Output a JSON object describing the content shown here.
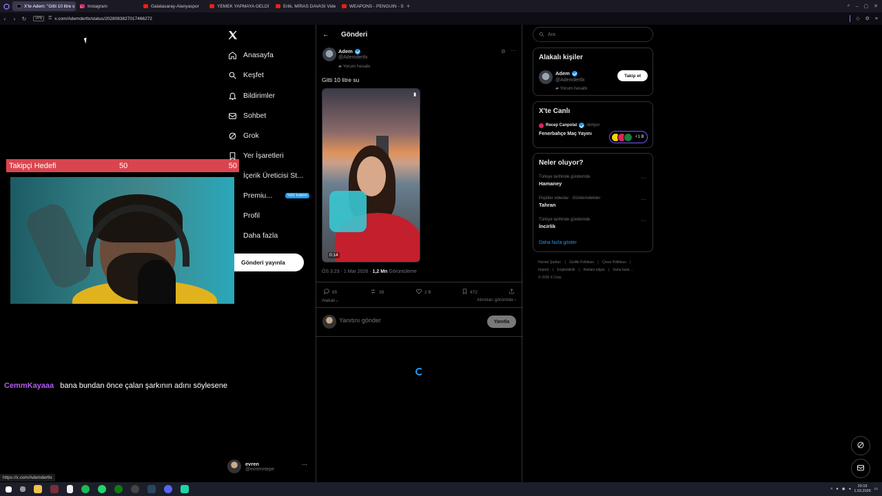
{
  "browser": {
    "tabs": [
      {
        "label": "X'te Adem: \"Gitti 10 litre s",
        "active": true,
        "icon": "x-icon"
      },
      {
        "label": "Instagram",
        "active": false,
        "icon": "instagram-icon"
      },
      {
        "label": "Galatasaray-Alanyaspor",
        "active": false,
        "icon": "youtube-icon"
      },
      {
        "label": "YEMEK YAPMAYA GELDİ",
        "active": false,
        "icon": "youtube-icon"
      },
      {
        "label": "Erlik, MİRAS DAVASI Vide",
        "active": false,
        "icon": "youtube-icon"
      },
      {
        "label": "WEAPONS - PENGUIN - S",
        "active": false,
        "icon": "youtube-icon"
      }
    ],
    "new_tab": "+",
    "vpn_label": "VPN",
    "url": "x.com/Ademdertlx/status/2028083827017466272",
    "status_url": "https://x.com/Ademdertlx"
  },
  "overlay": {
    "follower_goal": {
      "label": "Takipçi Hedefi",
      "current": "50",
      "target": "50"
    },
    "chat": {
      "username": "CemmKayaaa",
      "message": "bana bundan önce çalan şarkının adını söylesene"
    }
  },
  "nav": {
    "items": [
      {
        "label": "Anasayfa",
        "icon": "home-icon"
      },
      {
        "label": "Keşfet",
        "icon": "search-icon"
      },
      {
        "label": "Bildirimler",
        "icon": "bell-icon"
      },
      {
        "label": "Sohbet",
        "icon": "mail-icon"
      },
      {
        "label": "Grok",
        "icon": "grok-icon"
      },
      {
        "label": "Yer İşaretleri",
        "icon": "bookmark-icon"
      },
      {
        "label": "İçerik Üreticisi St...",
        "icon": "creator-icon"
      },
      {
        "label": "Premiu...",
        "icon": "premium-icon"
      },
      {
        "label": "Profil",
        "icon": "profile-icon"
      },
      {
        "label": "Daha fazla",
        "icon": "more-icon"
      }
    ],
    "premium_badge": "%50 İndirim",
    "post_button": "Gönderi yayınla",
    "account": {
      "name": "evren",
      "handle": "@evrenntepe",
      "more": "···"
    }
  },
  "post": {
    "header_title": "Gönderi",
    "author": {
      "name": "Adem",
      "handle": "@Ademdertlx",
      "tag": "Yorum hesabı"
    },
    "text": "Gitti 10 litre su",
    "video_time": "0:14",
    "meta": {
      "time": "ÖS 3:23 · 1 Mar 2026 · ",
      "views_count": "1,2 Mn",
      "views_label": " Görüntüleme"
    },
    "actions": {
      "replies": "85",
      "reposts": "38",
      "likes": "2 B",
      "bookmarks": "472"
    },
    "relevant_label": "Alakalı",
    "quotes_label": "Alıntıları görüntüle",
    "reply_placeholder": "Yanıtını gönder",
    "reply_button": "Yanıtla"
  },
  "sidebar": {
    "search_placeholder": "Ara",
    "related": {
      "title": "Alakalı kişiler",
      "name": "Adem",
      "handle": "@Ademdertlx",
      "tag": "Yorum hesabı",
      "follow_label": "Takip et"
    },
    "live": {
      "title": "X'te Canlı",
      "host": "Recep Canpolat",
      "listening": "dinliyor",
      "space_title": "Fenerbahçe Maç Yayını",
      "listener_count": "+1 B"
    },
    "trends": {
      "title": "Neler oluyor?",
      "items": [
        {
          "meta": "Türkiye tarihinde gündemde",
          "name": "Hamaney"
        },
        {
          "meta": "Popüler videolar · Gündemdekiler",
          "name": "Tahran"
        },
        {
          "meta": "Türkiye tarihinde gündemde",
          "name": "İncirlik"
        }
      ],
      "show_more": "Daha fazla göster"
    },
    "footer": [
      "Hizmet Şartları",
      "|",
      "Gizlilik Politikası",
      "|",
      "Çerez Politikası",
      "|",
      "Imprint",
      "|",
      "Erişilebilirlik",
      "|",
      "Reklam bilgisi",
      "|",
      "Daha fazla ...",
      "© 2026 X Corp."
    ]
  },
  "taskbar": {
    "clock_time": "20:19",
    "clock_date": "1.03.2026"
  }
}
